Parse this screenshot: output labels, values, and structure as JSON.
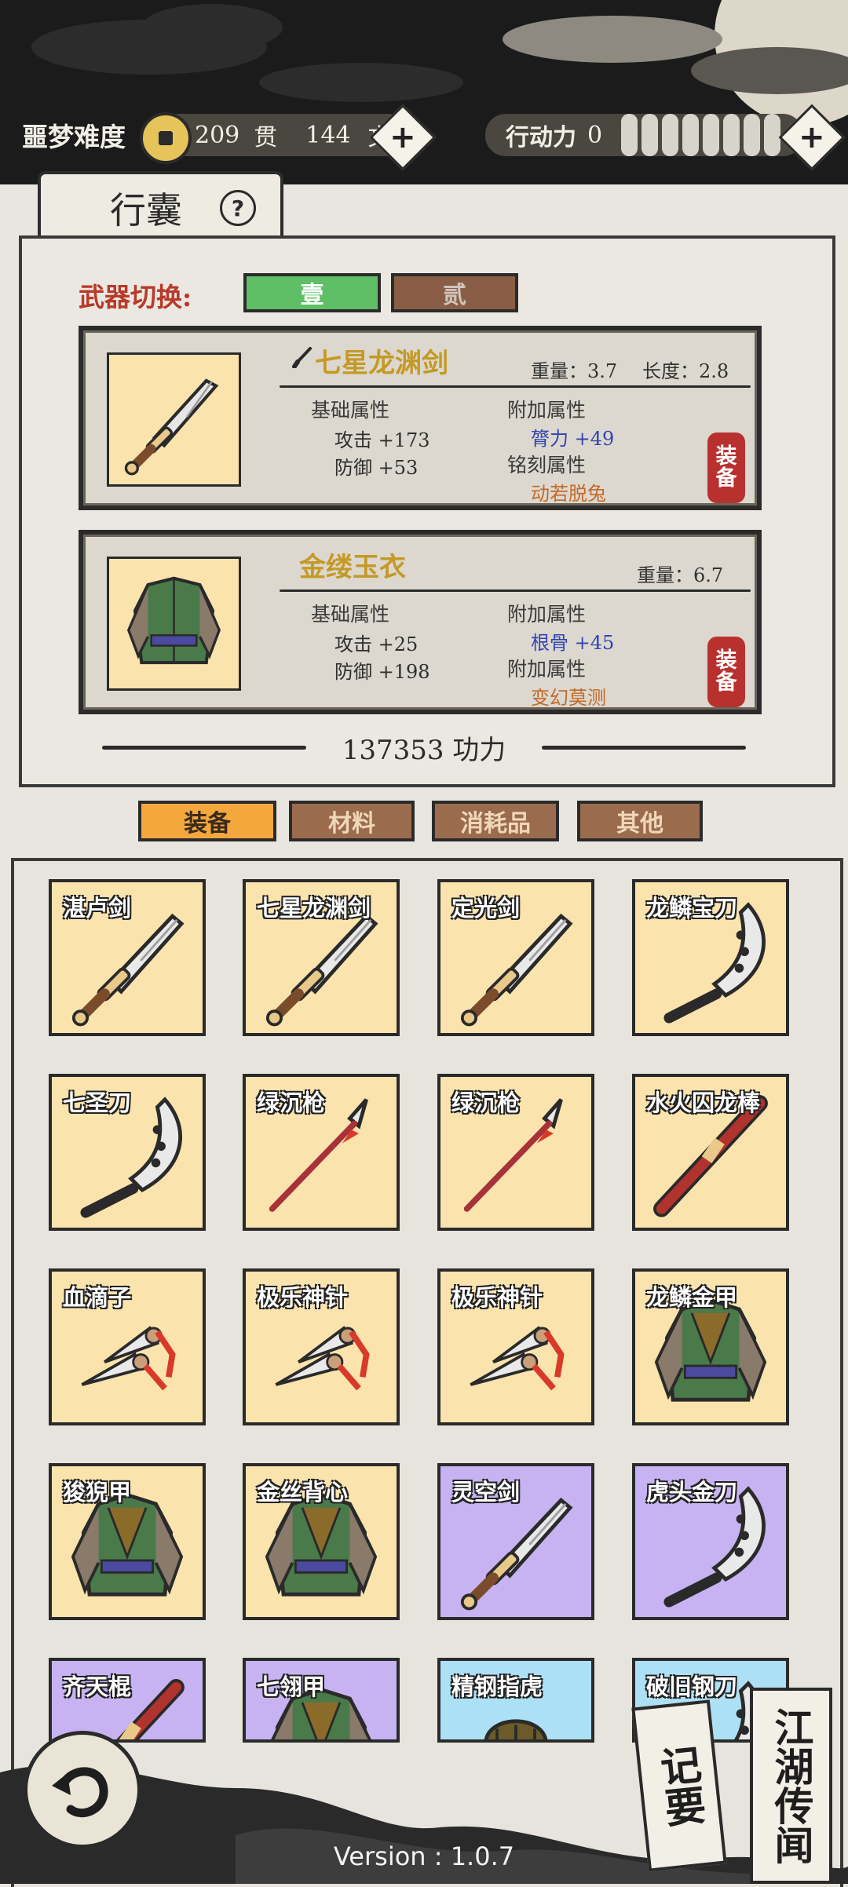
{
  "header": {
    "difficulty": "噩梦难度",
    "currency_guan": "209",
    "currency_guan_unit": "贯",
    "currency_wen": "144",
    "currency_wen_unit": "文",
    "action_label": "行动力",
    "action_value": "0",
    "action_level": 0
  },
  "bag": {
    "tab_title": "行囊",
    "help_icon": "question-icon",
    "weapon_switch_label": "武器切换:",
    "weapon_slots": [
      "壹",
      "贰"
    ],
    "weapon_slot_active": 0
  },
  "equipped": {
    "weapon": {
      "name": "七星龙渊剑",
      "weight": "重量：3.7",
      "length": "长度：2.8",
      "base_title": "基础属性",
      "attack": "攻击 +173",
      "defense": "防御 +53",
      "extra_title": "附加属性",
      "extra_stat": "膂力 +49",
      "engrave_title": "铭刻属性",
      "engrave_value": "动若脱兔",
      "equip_label_1": "装",
      "equip_label_2": "备"
    },
    "armor": {
      "name": "金缕玉衣",
      "weight": "重量：6.7",
      "base_title": "基础属性",
      "attack": "攻击 +25",
      "defense": "防御 +198",
      "extra_title": "附加属性",
      "extra_stat": "根骨 +45",
      "extra_title_2": "附加属性",
      "extra_value_2": "变幻莫测",
      "equip_label_1": "装",
      "equip_label_2": "备"
    },
    "power": "137353 功力"
  },
  "categories": [
    "装备",
    "材料",
    "消耗品",
    "其他"
  ],
  "category_active": 0,
  "items": [
    {
      "name": "湛卢剑",
      "icon": "sword-icon",
      "rarity": "gold"
    },
    {
      "name": "七星龙渊剑",
      "icon": "sword-icon",
      "rarity": "gold"
    },
    {
      "name": "定光剑",
      "icon": "sword-icon",
      "rarity": "gold"
    },
    {
      "name": "龙鳞宝刀",
      "icon": "saber-icon",
      "rarity": "gold"
    },
    {
      "name": "七圣刀",
      "icon": "saber-icon",
      "rarity": "gold"
    },
    {
      "name": "绿沉枪",
      "icon": "spear-icon",
      "rarity": "gold"
    },
    {
      "name": "绿沉枪",
      "icon": "spear-icon",
      "rarity": "gold"
    },
    {
      "name": "水火囚龙棒",
      "icon": "staff-icon",
      "rarity": "gold"
    },
    {
      "name": "血滴子",
      "icon": "dart-icon",
      "rarity": "gold"
    },
    {
      "name": "极乐神针",
      "icon": "dart-icon",
      "rarity": "gold"
    },
    {
      "name": "极乐神针",
      "icon": "dart-icon",
      "rarity": "gold"
    },
    {
      "name": "龙鳞金甲",
      "icon": "armor-icon",
      "rarity": "gold"
    },
    {
      "name": "狻猊甲",
      "icon": "armor-icon",
      "rarity": "gold"
    },
    {
      "name": "金丝背心",
      "icon": "armor-icon",
      "rarity": "gold"
    },
    {
      "name": "灵空剑",
      "icon": "sword-icon",
      "rarity": "purple"
    },
    {
      "name": "虎头金刀",
      "icon": "saber-icon",
      "rarity": "purple"
    },
    {
      "name": "齐天棍",
      "icon": "staff-icon",
      "rarity": "purple"
    },
    {
      "name": "七翎甲",
      "icon": "armor-icon",
      "rarity": "purple"
    },
    {
      "name": "精钢指虎",
      "icon": "knuckle-icon",
      "rarity": "blue"
    },
    {
      "name": "破旧钢刀",
      "icon": "saber-icon",
      "rarity": "blue"
    }
  ],
  "footer": {
    "back_icon": "back-arrow-icon",
    "notes_label": "记要",
    "rumors_label": "江湖传闻",
    "version": "Version : 1.0.7"
  },
  "colors": {
    "gold_cell": "#fbe3ad",
    "purple_cell": "#c7b3f2",
    "blue_cell": "#aee0f5",
    "equip_red": "#b8312f",
    "active_tab": "#f4a73d",
    "inactive_tab": "#9b6b4e",
    "slot_active": "#5fbf66"
  }
}
